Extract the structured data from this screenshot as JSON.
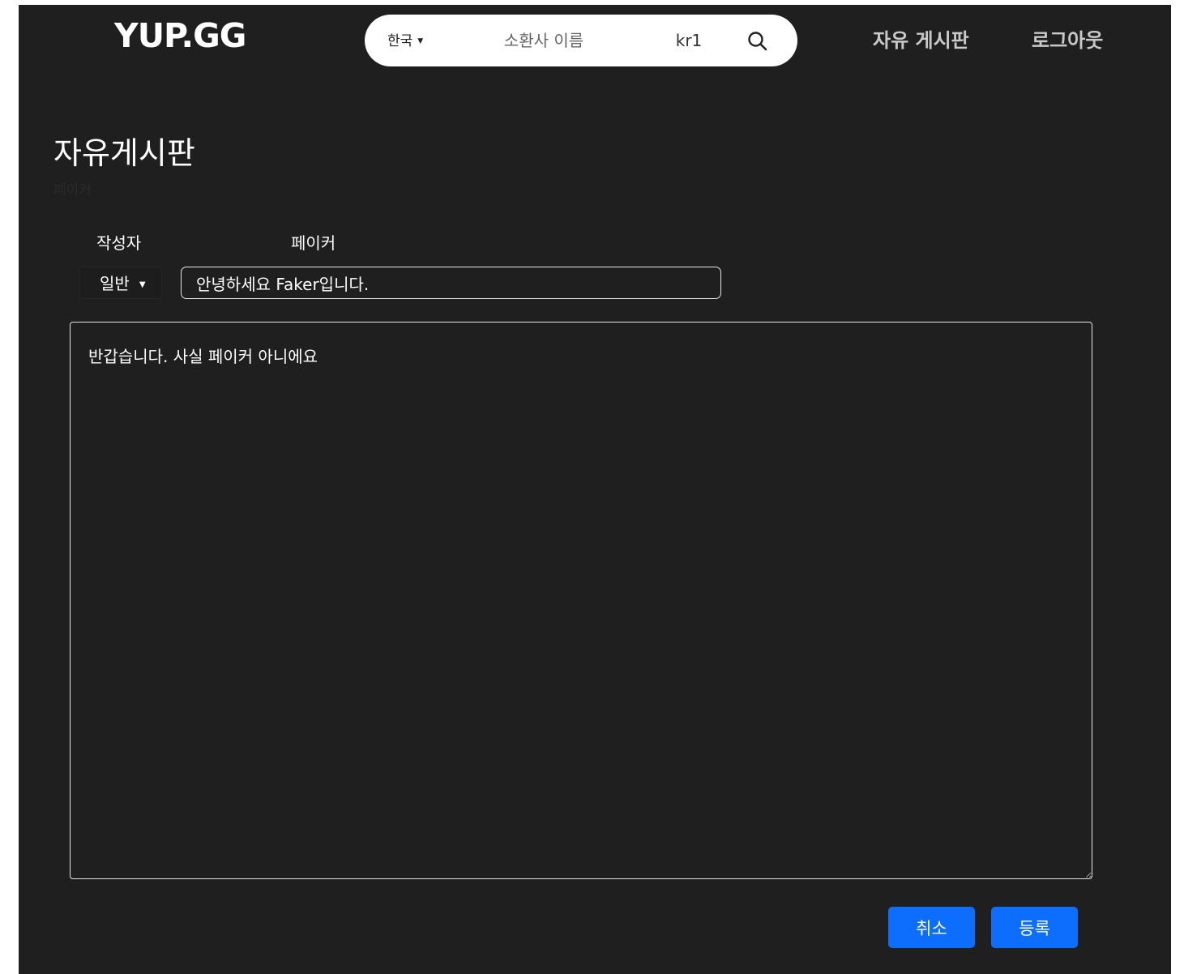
{
  "header": {
    "logo": "YUP.GG",
    "search": {
      "region": "한국",
      "summoner_placeholder": "소환사 이름",
      "tag_value": "kr1"
    },
    "nav": {
      "board": "자유 게시판",
      "logout": "로그아웃"
    }
  },
  "page": {
    "title": "자유게시판",
    "subtitle": "페이커"
  },
  "form": {
    "author_label": "작성자",
    "author_name": "페이커",
    "category": "일반",
    "title_value": "안녕하세요 Faker입니다.",
    "body_value": "반갑습니다. 사실 페이커 아니에요",
    "cancel_label": "취소",
    "submit_label": "등록"
  },
  "colors": {
    "background": "#1f1f1f",
    "accent": "#0d6efd"
  }
}
